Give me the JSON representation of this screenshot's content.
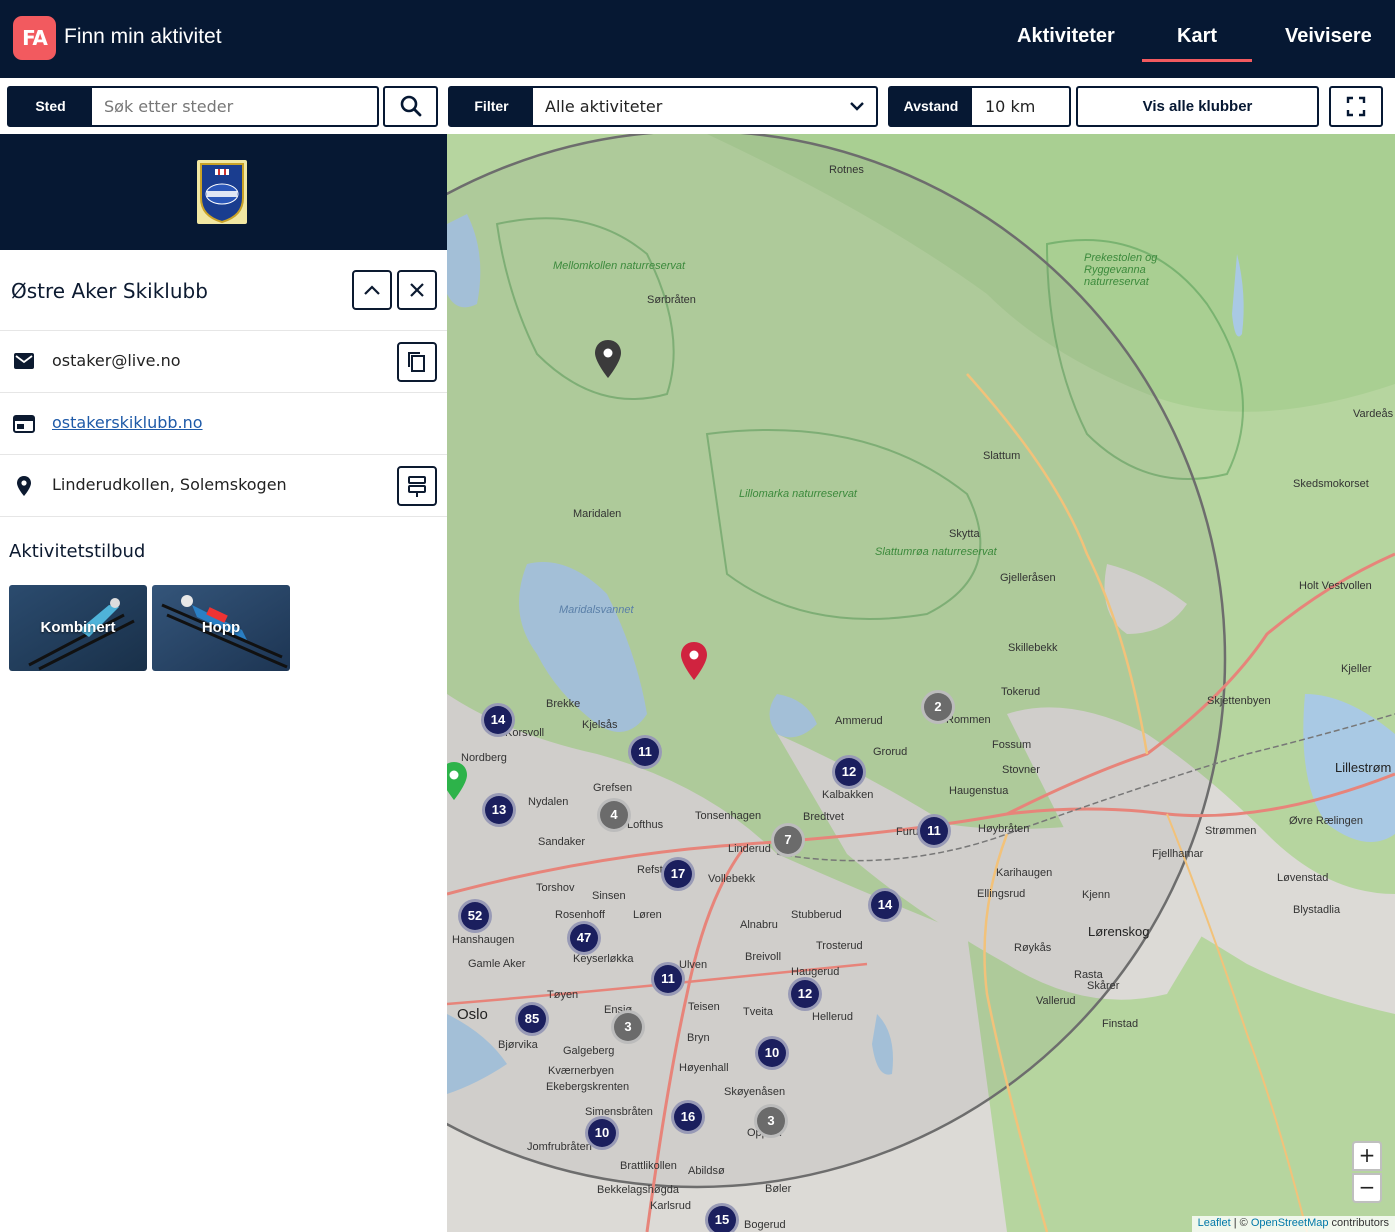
{
  "app": {
    "logo_text": "FA",
    "title": "Finn min aktivitet"
  },
  "nav": {
    "items": [
      "Aktiviteter",
      "Kart",
      "Veivisere"
    ],
    "active": "Kart"
  },
  "toolbar": {
    "place_tag": "Sted",
    "place_placeholder": "Søk etter steder",
    "filter_tag": "Filter",
    "filter_value": "Alle aktiviteter",
    "distance_tag": "Avstand",
    "distance_value": "10 km",
    "show_all_button": "Vis alle klubber"
  },
  "club": {
    "name": "Østre Aker Skiklubb",
    "email": "ostaker@live.no",
    "website": "ostakerskiklubb.no",
    "location": "Linderudkollen, Solemskogen",
    "activities_title": "Aktivitetstilbud",
    "activities": [
      "Kombinert",
      "Hopp"
    ]
  },
  "map": {
    "zoom_in": "+",
    "zoom_out": "−",
    "attribution_leaflet": "Leaflet",
    "attribution_sep": " | © ",
    "attribution_osm": "OpenStreetMap",
    "attribution_tail": " contributors",
    "clusters": [
      {
        "count": "14",
        "color": "navy"
      },
      {
        "count": "11",
        "color": "navy"
      },
      {
        "count": "2",
        "color": "gray"
      },
      {
        "count": "12",
        "color": "navy"
      },
      {
        "count": "13",
        "color": "navy"
      },
      {
        "count": "4",
        "color": "gray"
      },
      {
        "count": "7",
        "color": "gray"
      },
      {
        "count": "11",
        "color": "navy"
      },
      {
        "count": "17",
        "color": "navy"
      },
      {
        "count": "14",
        "color": "navy"
      },
      {
        "count": "52",
        "color": "navy"
      },
      {
        "count": "47",
        "color": "navy"
      },
      {
        "count": "11",
        "color": "navy"
      },
      {
        "count": "12",
        "color": "navy"
      },
      {
        "count": "85",
        "color": "navy"
      },
      {
        "count": "3",
        "color": "gray"
      },
      {
        "count": "10",
        "color": "navy"
      },
      {
        "count": "16",
        "color": "navy"
      },
      {
        "count": "3",
        "color": "gray"
      },
      {
        "count": "10",
        "color": "navy"
      },
      {
        "count": "15",
        "color": "navy"
      }
    ],
    "places": [
      "Rotnes",
      "Mellomkollen naturreservat",
      "Sørbråten",
      "Prekestolen og Ryggevanna naturreservat",
      "Vardeås",
      "Slattum",
      "Lillomarka naturreservat",
      "Maridalen",
      "Skytta",
      "Skedsmokorset",
      "Slattumrøa naturreservat",
      "Gjelleråsen",
      "Holt Vestvollen",
      "Maridalsvannet",
      "Skillebekk",
      "Kjeller",
      "Tokerud",
      "Skjettenbyen",
      "Brekke",
      "Kjelsås",
      "Ammerud",
      "Rommen",
      "Korsvoll",
      "Grorud",
      "Fossum",
      "Nordberg",
      "Stovner",
      "Lillestrøm",
      "Grefsen",
      "Kalbakken",
      "Haugenstua",
      "Nydalen",
      "Lofthus",
      "Tonsenhagen",
      "Bredtvet",
      "Høybråten",
      "Strømmen",
      "Øvre Rælingen",
      "Sandaker",
      "Linderud",
      "Fjellhamar",
      "Refstad",
      "Vollebekk",
      "Karihaugen",
      "Løvenstad",
      "Torshov",
      "Sinsen",
      "Ellingsrud",
      "Kjenn",
      "Blystadlia",
      "Rosenhoff",
      "Løren",
      "Stubberud",
      "Hanshaugen",
      "Alnabru",
      "Lørenskog",
      "Keyserløkka",
      "Trosterud",
      "Røykås",
      "Gamle Aker",
      "Ulven",
      "Breivoll",
      "Rasta",
      "Tøyen",
      "Haugerud",
      "Skårer",
      "Oslo",
      "Ensjø",
      "Teisen",
      "Tveita",
      "Hellerud",
      "Vallerud",
      "Finstad",
      "Bjørvika",
      "Galgeberg",
      "Bryn",
      "Kværnerbyen",
      "Høyenhall",
      "Ekebergskrenten",
      "Skøyenåsen",
      "Simensbråten",
      "Jomfrubråten",
      "Brattlikollen",
      "Abildsø",
      "Bøler",
      "Bekkelagshøgda",
      "Karlsrud",
      "Bogerud",
      "Furuset",
      "Oppsal"
    ]
  }
}
